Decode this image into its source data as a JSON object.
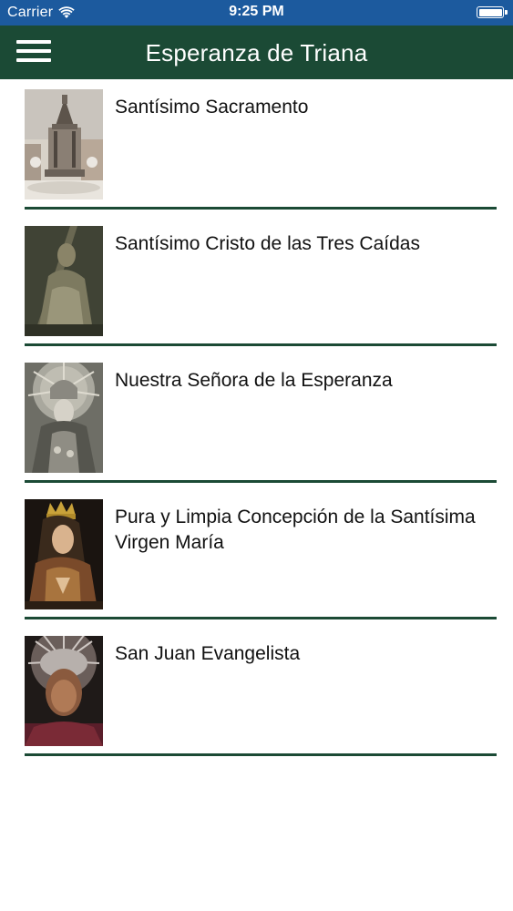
{
  "status_bar": {
    "carrier": "Carrier",
    "time": "9:25 PM",
    "wifi_icon": "wifi-icon",
    "battery_icon": "battery-icon"
  },
  "nav": {
    "title": "Esperanza de Triana",
    "menu_icon": "hamburger-menu-icon",
    "background_color": "#1b4a35"
  },
  "colors": {
    "status_bar": "#1c5a9e",
    "nav_bar": "#1b4a35",
    "separator": "#1b4a35",
    "text": "#111111",
    "background": "#ffffff"
  },
  "items": [
    {
      "title": "Santísimo Sacramento",
      "thumbnail": "monstrance-photo"
    },
    {
      "title": "Santísimo Cristo de las Tres Caídas",
      "thumbnail": "christ-cross-photo"
    },
    {
      "title": "Nuestra Señora de la Esperanza",
      "thumbnail": "virgin-esperanza-photo"
    },
    {
      "title": "Pura y Limpia Concepción de la Santísima Virgen María",
      "thumbnail": "immaculate-conception-photo"
    },
    {
      "title": "San Juan Evangelista",
      "thumbnail": "saint-john-photo"
    }
  ]
}
